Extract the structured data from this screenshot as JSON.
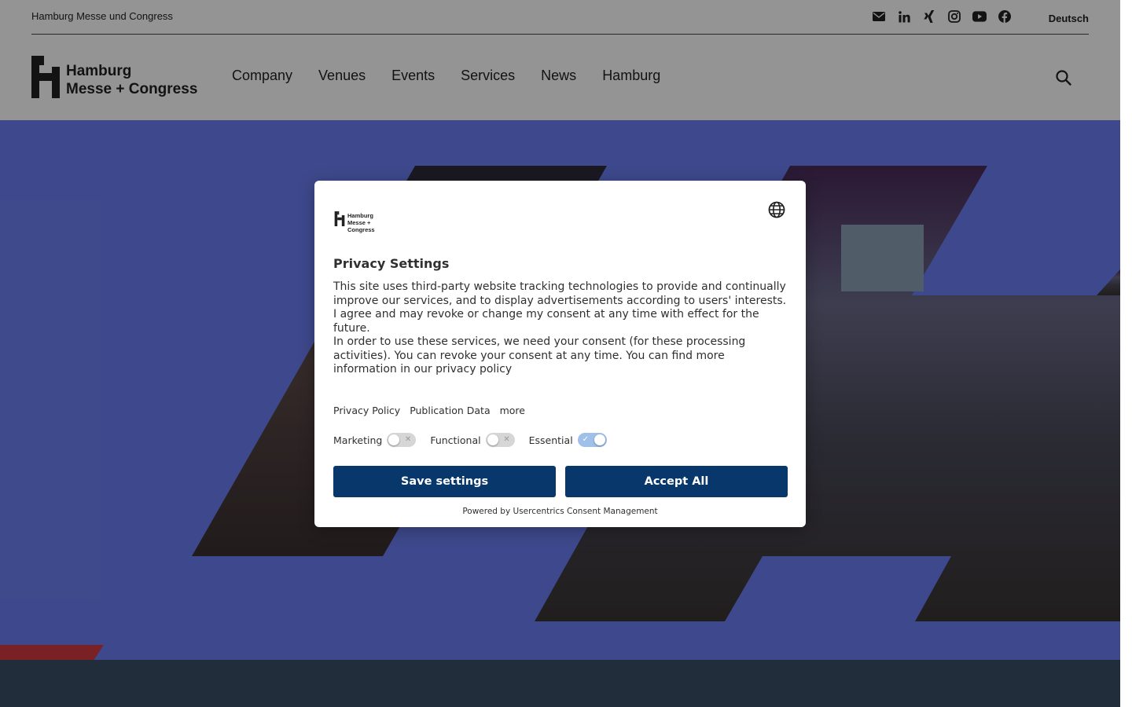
{
  "topbar": {
    "org_name": "Hamburg Messe und Congress",
    "social_icons": [
      "mail-icon",
      "linkedin-icon",
      "xing-icon",
      "instagram-icon",
      "youtube-icon",
      "facebook-icon"
    ],
    "language": "Deutsch"
  },
  "header": {
    "logo_line1": "Hamburg",
    "logo_line2": "Messe + Congress",
    "nav": [
      "Company",
      "Venues",
      "Events",
      "Services",
      "News",
      "Hamburg"
    ],
    "search_icon": "search-icon"
  },
  "colors": {
    "hero_bg": "#6c7ff3",
    "footer_band": "#3a4e66",
    "accent_red": "#d03a3f",
    "button_bg": "#08376b",
    "overlay": "rgba(0,0,0,0.42)"
  },
  "dialog": {
    "logo_line1": "Hamburg",
    "logo_line2": "Messe + Congress",
    "language_icon": "globe-icon",
    "title": "Privacy Settings",
    "body_p1": "This site uses third-party website tracking technologies to provide and continually improve our services, and to display advertisements according to users' interests. I agree and may revoke or change my consent at any time with effect for the future.",
    "body_p2": "In order to use these services, we need your consent (for these processing activities). You can revoke your consent at any time. You can find more information in our privacy policy",
    "links": [
      "Privacy Policy",
      "Publication Data",
      "more"
    ],
    "toggles": [
      {
        "label": "Marketing",
        "state": "off"
      },
      {
        "label": "Functional",
        "state": "off"
      },
      {
        "label": "Essential",
        "state": "on"
      }
    ],
    "save_label": "Save settings",
    "accept_label": "Accept All",
    "powered_by": "Powered by Usercentrics Consent Management"
  }
}
